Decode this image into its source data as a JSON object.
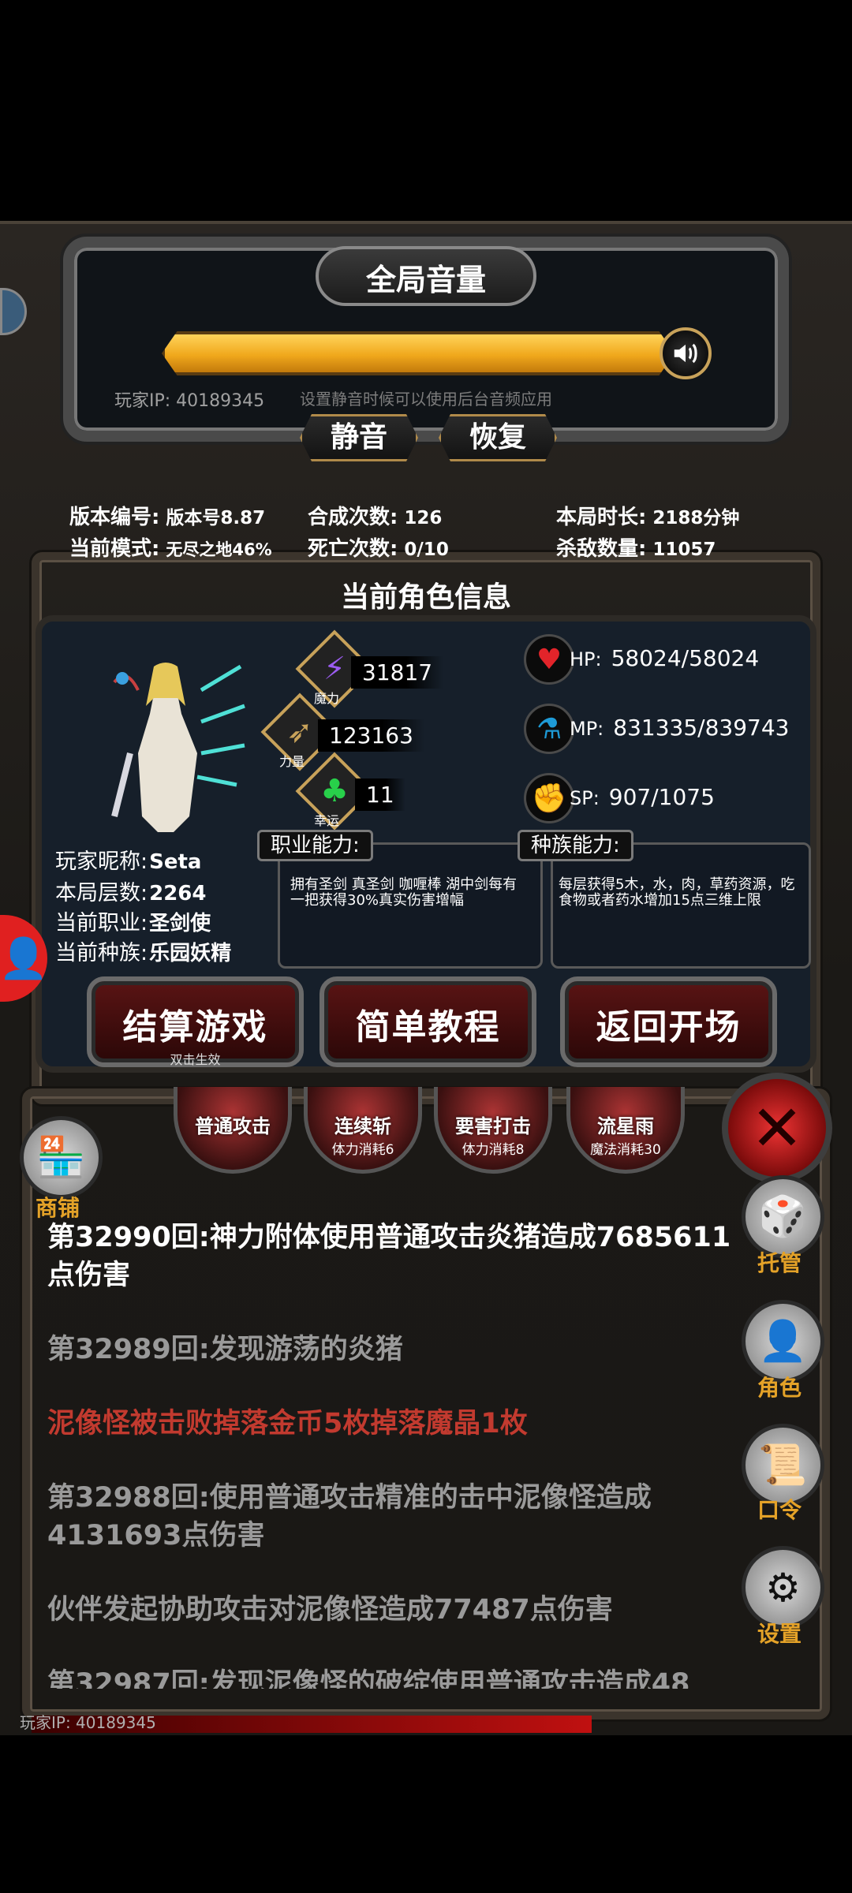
{
  "volume": {
    "title": "全局音量",
    "level": 1.0,
    "player_ip": "玩家IP: 40189345",
    "hint": "设置静音时候可以使用后台音频应用",
    "mute_label": "静音",
    "restore_label": "恢复"
  },
  "stats": {
    "version_label": "版本编号:",
    "version_value": "版本号8.87",
    "mode_label": "当前模式:",
    "mode_value": "无尽之地46%",
    "synth_label": "合成次数:",
    "synth_value": "126",
    "death_label": "死亡次数:",
    "death_value": "0/10",
    "duration_label": "本局时长:",
    "duration_value": "2188分钟",
    "kills_label": "杀敌数量:",
    "kills_value": "11057"
  },
  "character": {
    "section_title": "当前角色信息",
    "attributes": [
      {
        "name": "魔力",
        "value": "31817",
        "icon": "lightning-icon",
        "color": "#9b5cf0"
      },
      {
        "name": "力量",
        "value": "123163",
        "icon": "bow-icon",
        "color": "#c8a25a"
      },
      {
        "name": "幸运",
        "value": "11",
        "icon": "clover-icon",
        "color": "#28d04a"
      }
    ],
    "resources": [
      {
        "label": "HP:",
        "value": "58024/58024",
        "icon": "heart-icon",
        "color": "#e2242a"
      },
      {
        "label": "MP:",
        "value": "831335/839743",
        "icon": "potion-icon",
        "color": "#1e9bd7"
      },
      {
        "label": "SP:",
        "value": "907/1075",
        "icon": "stamina-icon",
        "color": "#e8b21b"
      }
    ],
    "nickname_label": "玩家昵称:",
    "nickname": "Seta",
    "floor_label": "本局层数:",
    "floor": "2264",
    "class_label": "当前职业:",
    "class": "圣剑使",
    "race_label": "当前种族:",
    "race": "乐园妖精",
    "class_ability_title": "职业能力:",
    "class_ability_text": "拥有圣剑 真圣剑 咖喱棒 湖中剑每有一把获得30%真实伤害增幅",
    "race_ability_title": "种族能力:",
    "race_ability_text": "每层获得5木，水，肉，草药资源，吃食物或者药水增加15点三维上限"
  },
  "actions": {
    "settle_label": "结算游戏",
    "settle_sub": "双击生效",
    "tutorial_label": "简单教程",
    "back_label": "返回开场"
  },
  "skills": [
    {
      "name": "普通攻击",
      "cost": ""
    },
    {
      "name": "连续斩",
      "cost": "体力消耗6"
    },
    {
      "name": "要害打击",
      "cost": "体力消耗8"
    },
    {
      "name": "流星雨",
      "cost": "魔法消耗30"
    }
  ],
  "side": {
    "shop_label": "商铺",
    "auto_label": "托管",
    "role_label": "角色",
    "code_label": "口令",
    "settings_label": "设置"
  },
  "log": [
    {
      "text": "第32990回:神力附体使用普通攻击炎猪造成7685611点伤害",
      "color": "#ffffff"
    },
    {
      "text": "第32989回:发现游荡的炎猪",
      "color": "#9a9a9a"
    },
    {
      "text": "泥像怪被击败掉落金币5枚掉落魔晶1枚",
      "color": "#c23a2f"
    },
    {
      "text": "第32988回:使用普通攻击精准的击中泥像怪造成4131693点伤害",
      "color": "#9a9a9a"
    },
    {
      "text": "伙伴发起协助攻击对泥像怪造成77487点伤害",
      "color": "#9a9a9a"
    },
    {
      "text": "第32987回:发现泥像怪的破绽使用普通攻击造成48",
      "color": "#9a9a9a"
    }
  ],
  "footer": {
    "player_ip": "玩家IP: 40189345"
  }
}
